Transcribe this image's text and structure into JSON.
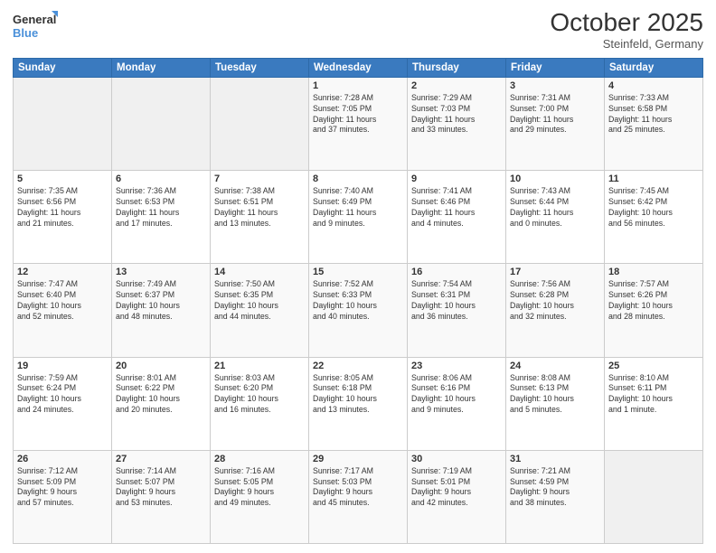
{
  "header": {
    "logo_line1": "General",
    "logo_line2": "Blue",
    "month": "October 2025",
    "location": "Steinfeld, Germany"
  },
  "days_of_week": [
    "Sunday",
    "Monday",
    "Tuesday",
    "Wednesday",
    "Thursday",
    "Friday",
    "Saturday"
  ],
  "weeks": [
    [
      {
        "day": "",
        "info": ""
      },
      {
        "day": "",
        "info": ""
      },
      {
        "day": "",
        "info": ""
      },
      {
        "day": "1",
        "info": "Sunrise: 7:28 AM\nSunset: 7:05 PM\nDaylight: 11 hours\nand 37 minutes."
      },
      {
        "day": "2",
        "info": "Sunrise: 7:29 AM\nSunset: 7:03 PM\nDaylight: 11 hours\nand 33 minutes."
      },
      {
        "day": "3",
        "info": "Sunrise: 7:31 AM\nSunset: 7:00 PM\nDaylight: 11 hours\nand 29 minutes."
      },
      {
        "day": "4",
        "info": "Sunrise: 7:33 AM\nSunset: 6:58 PM\nDaylight: 11 hours\nand 25 minutes."
      }
    ],
    [
      {
        "day": "5",
        "info": "Sunrise: 7:35 AM\nSunset: 6:56 PM\nDaylight: 11 hours\nand 21 minutes."
      },
      {
        "day": "6",
        "info": "Sunrise: 7:36 AM\nSunset: 6:53 PM\nDaylight: 11 hours\nand 17 minutes."
      },
      {
        "day": "7",
        "info": "Sunrise: 7:38 AM\nSunset: 6:51 PM\nDaylight: 11 hours\nand 13 minutes."
      },
      {
        "day": "8",
        "info": "Sunrise: 7:40 AM\nSunset: 6:49 PM\nDaylight: 11 hours\nand 9 minutes."
      },
      {
        "day": "9",
        "info": "Sunrise: 7:41 AM\nSunset: 6:46 PM\nDaylight: 11 hours\nand 4 minutes."
      },
      {
        "day": "10",
        "info": "Sunrise: 7:43 AM\nSunset: 6:44 PM\nDaylight: 11 hours\nand 0 minutes."
      },
      {
        "day": "11",
        "info": "Sunrise: 7:45 AM\nSunset: 6:42 PM\nDaylight: 10 hours\nand 56 minutes."
      }
    ],
    [
      {
        "day": "12",
        "info": "Sunrise: 7:47 AM\nSunset: 6:40 PM\nDaylight: 10 hours\nand 52 minutes."
      },
      {
        "day": "13",
        "info": "Sunrise: 7:49 AM\nSunset: 6:37 PM\nDaylight: 10 hours\nand 48 minutes."
      },
      {
        "day": "14",
        "info": "Sunrise: 7:50 AM\nSunset: 6:35 PM\nDaylight: 10 hours\nand 44 minutes."
      },
      {
        "day": "15",
        "info": "Sunrise: 7:52 AM\nSunset: 6:33 PM\nDaylight: 10 hours\nand 40 minutes."
      },
      {
        "day": "16",
        "info": "Sunrise: 7:54 AM\nSunset: 6:31 PM\nDaylight: 10 hours\nand 36 minutes."
      },
      {
        "day": "17",
        "info": "Sunrise: 7:56 AM\nSunset: 6:28 PM\nDaylight: 10 hours\nand 32 minutes."
      },
      {
        "day": "18",
        "info": "Sunrise: 7:57 AM\nSunset: 6:26 PM\nDaylight: 10 hours\nand 28 minutes."
      }
    ],
    [
      {
        "day": "19",
        "info": "Sunrise: 7:59 AM\nSunset: 6:24 PM\nDaylight: 10 hours\nand 24 minutes."
      },
      {
        "day": "20",
        "info": "Sunrise: 8:01 AM\nSunset: 6:22 PM\nDaylight: 10 hours\nand 20 minutes."
      },
      {
        "day": "21",
        "info": "Sunrise: 8:03 AM\nSunset: 6:20 PM\nDaylight: 10 hours\nand 16 minutes."
      },
      {
        "day": "22",
        "info": "Sunrise: 8:05 AM\nSunset: 6:18 PM\nDaylight: 10 hours\nand 13 minutes."
      },
      {
        "day": "23",
        "info": "Sunrise: 8:06 AM\nSunset: 6:16 PM\nDaylight: 10 hours\nand 9 minutes."
      },
      {
        "day": "24",
        "info": "Sunrise: 8:08 AM\nSunset: 6:13 PM\nDaylight: 10 hours\nand 5 minutes."
      },
      {
        "day": "25",
        "info": "Sunrise: 8:10 AM\nSunset: 6:11 PM\nDaylight: 10 hours\nand 1 minute."
      }
    ],
    [
      {
        "day": "26",
        "info": "Sunrise: 7:12 AM\nSunset: 5:09 PM\nDaylight: 9 hours\nand 57 minutes."
      },
      {
        "day": "27",
        "info": "Sunrise: 7:14 AM\nSunset: 5:07 PM\nDaylight: 9 hours\nand 53 minutes."
      },
      {
        "day": "28",
        "info": "Sunrise: 7:16 AM\nSunset: 5:05 PM\nDaylight: 9 hours\nand 49 minutes."
      },
      {
        "day": "29",
        "info": "Sunrise: 7:17 AM\nSunset: 5:03 PM\nDaylight: 9 hours\nand 45 minutes."
      },
      {
        "day": "30",
        "info": "Sunrise: 7:19 AM\nSunset: 5:01 PM\nDaylight: 9 hours\nand 42 minutes."
      },
      {
        "day": "31",
        "info": "Sunrise: 7:21 AM\nSunset: 4:59 PM\nDaylight: 9 hours\nand 38 minutes."
      },
      {
        "day": "",
        "info": ""
      }
    ]
  ]
}
